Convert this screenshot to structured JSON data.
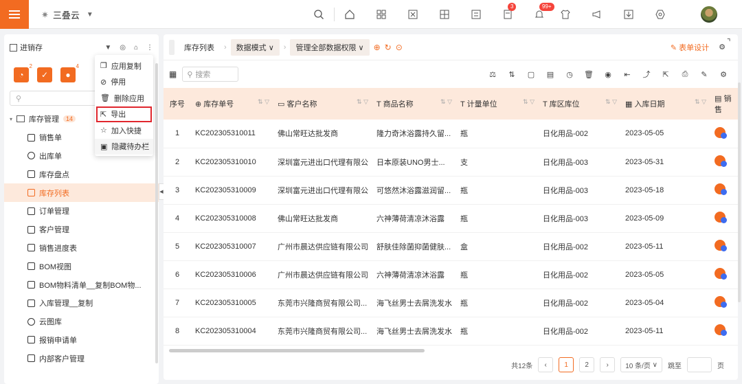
{
  "app": {
    "name": "三叠云"
  },
  "topbar": {
    "badges": {
      "tasks": "3",
      "notifications": "99+"
    }
  },
  "sidebar": {
    "title": "进销存",
    "search_placeholder": "",
    "quick_badges": [
      "2",
      "",
      "4"
    ],
    "root": {
      "label": "库存管理",
      "count": "14"
    },
    "items": [
      {
        "label": "销售单"
      },
      {
        "label": "出库单"
      },
      {
        "label": "库存盘点"
      },
      {
        "label": "库存列表"
      },
      {
        "label": "订单管理"
      },
      {
        "label": "客户管理"
      },
      {
        "label": "销售进度表"
      },
      {
        "label": "BOM视图"
      },
      {
        "label": "BOM物料清单__复制BOM物..."
      },
      {
        "label": "入库管理__复制"
      },
      {
        "label": "云图库"
      },
      {
        "label": "报销申请单"
      },
      {
        "label": "内部客户管理"
      }
    ]
  },
  "popup": {
    "items": [
      {
        "label": "应用复制"
      },
      {
        "label": "停用"
      },
      {
        "label": "删除应用"
      },
      {
        "label": "导出"
      },
      {
        "label": "加入快捷"
      },
      {
        "label": "隐藏待办栏"
      }
    ]
  },
  "breadcrumb": {
    "list": "库存列表",
    "mode": "数据模式",
    "perm": "管理全部数据权限",
    "form_design": "表单设计"
  },
  "toolbar": {
    "search_placeholder": "搜索"
  },
  "table": {
    "headers": [
      "序号",
      "库存单号",
      "客户名称",
      "商品名称",
      "计量单位",
      "库区库位",
      "入库日期",
      "销售"
    ],
    "rows": [
      {
        "seq": "1",
        "no": "KC202305310011",
        "customer": "佛山常旺达批发商",
        "product": "隆力奇沐浴露持久留...",
        "unit": "瓶",
        "loc": "日化用品-002",
        "date": "2023-05-05"
      },
      {
        "seq": "2",
        "no": "KC202305310010",
        "customer": "深圳富元进出口代理有限公",
        "product": "日本原装UNO男士...",
        "unit": "支",
        "loc": "日化用品-003",
        "date": "2023-05-31"
      },
      {
        "seq": "3",
        "no": "KC202305310009",
        "customer": "深圳富元进出口代理有限公",
        "product": "可悠然沐浴露滋润留...",
        "unit": "瓶",
        "loc": "日化用品-003",
        "date": "2023-05-18"
      },
      {
        "seq": "4",
        "no": "KC202305310008",
        "customer": "佛山常旺达批发商",
        "product": "六神薄荷清凉沐浴露",
        "unit": "瓶",
        "loc": "日化用品-003",
        "date": "2023-05-09"
      },
      {
        "seq": "5",
        "no": "KC202305310007",
        "customer": "广州市晨达供应链有限公司",
        "product": "舒肤佳除菌抑菌健肤...",
        "unit": "盒",
        "loc": "日化用品-002",
        "date": "2023-05-11"
      },
      {
        "seq": "6",
        "no": "KC202305310006",
        "customer": "广州市晨达供应链有限公司",
        "product": "六神薄荷清凉沐浴露",
        "unit": "瓶",
        "loc": "日化用品-002",
        "date": "2023-05-05"
      },
      {
        "seq": "7",
        "no": "KC202305310005",
        "customer": "东莞市兴隆商贸有限公司...",
        "product": "海飞丝男士去屑洗发水",
        "unit": "瓶",
        "loc": "日化用品-002",
        "date": "2023-05-04"
      },
      {
        "seq": "8",
        "no": "KC202305310004",
        "customer": "东莞市兴隆商贸有限公司...",
        "product": "海飞丝男士去屑洗发水",
        "unit": "瓶",
        "loc": "日化用品-002",
        "date": "2023-05-11"
      }
    ]
  },
  "pager": {
    "total": "共12条",
    "pages": [
      "1",
      "2"
    ],
    "size": "10 条/页",
    "jump_label": "跳至",
    "page_suffix": "页"
  },
  "colors": {
    "accent": "#f26b21",
    "header_bg": "#fde9dc",
    "highlight": "#e0262d"
  }
}
